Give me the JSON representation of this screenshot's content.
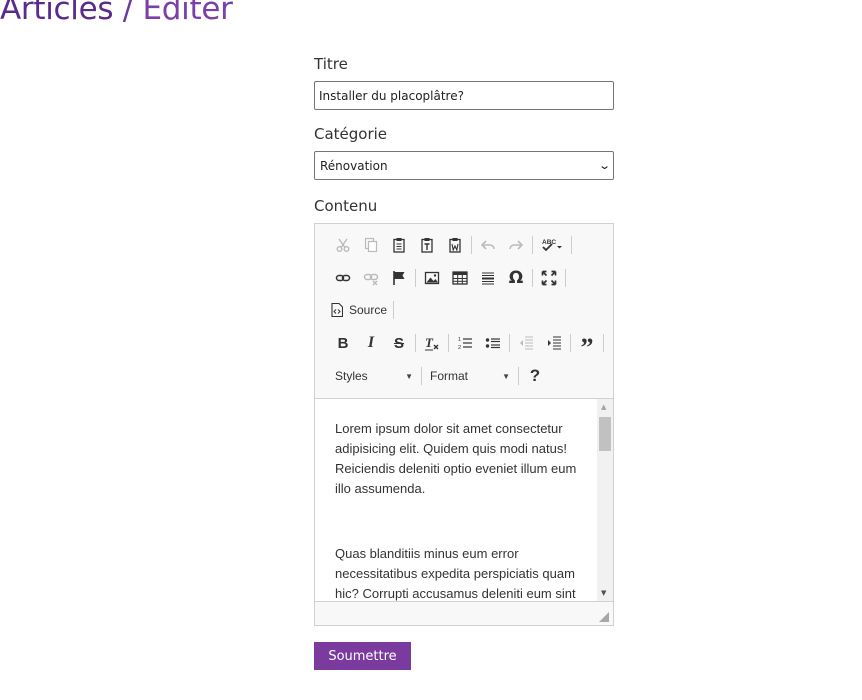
{
  "header": {
    "title_main": "Articles",
    "separator": "/",
    "title_sub": "Editer"
  },
  "form": {
    "title_label": "Titre",
    "title_value": "Installer du placoplâtre?",
    "category_label": "Catégorie",
    "category_value": "Rénovation",
    "content_label": "Contenu"
  },
  "editor": {
    "toolbar": {
      "source_label": "Source",
      "styles_label": "Styles",
      "format_label": "Format",
      "help_label": "?"
    },
    "paragraphs": [
      "Lorem ipsum dolor sit amet consectetur adipisicing elit. Quidem quis modi natus! Reiciendis deleniti optio eveniet illum eum illo assumenda.",
      "Quas blanditiis minus eum error necessitatibus expedita perspiciatis quam hic? Corrupti accusamus deleniti eum sint"
    ]
  },
  "submit_label": "Soumettre"
}
